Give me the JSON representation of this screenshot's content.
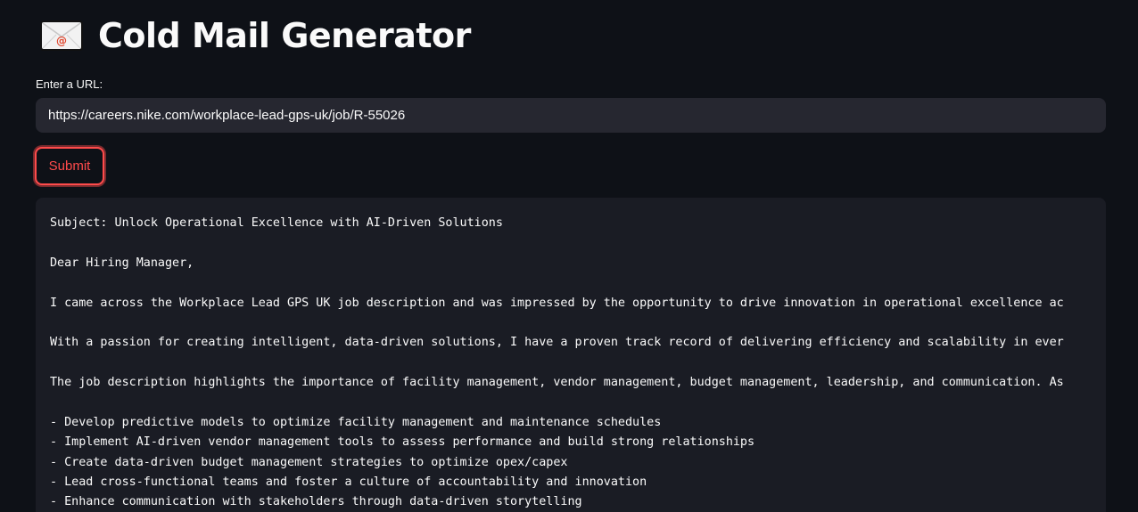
{
  "header": {
    "icon": "envelope-icon",
    "title": "Cold Mail Generator"
  },
  "url_input": {
    "label": "Enter a URL:",
    "value": "https://careers.nike.com/workplace-lead-gps-uk/job/R-55026"
  },
  "submit": {
    "label": "Submit"
  },
  "email_output": {
    "lines": [
      "Subject: Unlock Operational Excellence with AI-Driven Solutions",
      "",
      "Dear Hiring Manager,",
      "",
      "I came across the Workplace Lead GPS UK job description and was impressed by the opportunity to drive innovation in operational excellence ac",
      "",
      "With a passion for creating intelligent, data-driven solutions, I have a proven track record of delivering efficiency and scalability in ever",
      "",
      "The job description highlights the importance of facility management, vendor management, budget management, leadership, and communication. As",
      "",
      "- Develop predictive models to optimize facility management and maintenance schedules",
      "- Implement AI-driven vendor management tools to assess performance and build strong relationships",
      "- Create data-driven budget management strategies to optimize opex/capex",
      "- Lead cross-functional teams and foster a culture of accountability and innovation",
      "- Enhance communication with stakeholders through data-driven storytelling"
    ]
  },
  "colors": {
    "background": "#0e1117",
    "input_background": "#262730",
    "code_background": "#1a1c24",
    "accent": "#ff4b4b",
    "text": "#fafafa"
  }
}
